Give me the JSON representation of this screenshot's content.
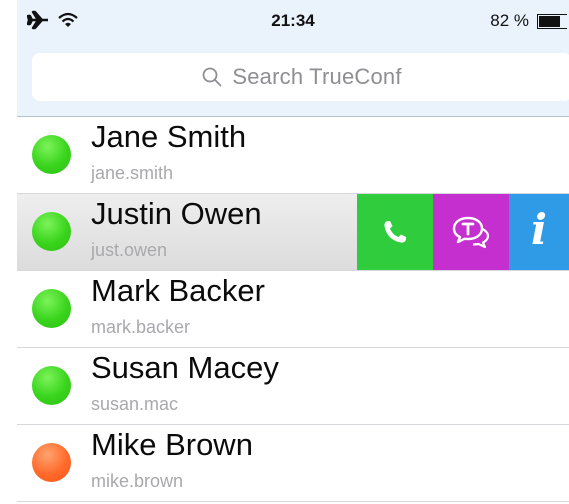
{
  "status_bar": {
    "airplane_icon": "airplane-icon",
    "wifi_icon": "wifi-icon",
    "time": "21:34",
    "battery_percent": "82 %",
    "battery_level": 0.82
  },
  "search": {
    "placeholder": "Search TrueConf"
  },
  "contacts": [
    {
      "name": "Jane Smith",
      "login": "jane.smith",
      "status": "online",
      "color": "#39d41c"
    },
    {
      "name": "Justin Owen",
      "login": "just.owen",
      "status": "online",
      "color": "#39d41c"
    },
    {
      "name": "Mark Backer",
      "login": "mark.backer",
      "status": "online",
      "color": "#39d41c"
    },
    {
      "name": "Susan Macey",
      "login": "susan.mac",
      "status": "online",
      "color": "#39d41c"
    },
    {
      "name": "Mike Brown",
      "login": "mike.brown",
      "status": "busy",
      "color": "#ff6a2a"
    }
  ],
  "swipe_actions": {
    "call": {
      "icon": "phone-icon",
      "color": "#2fcd3e"
    },
    "chat": {
      "icon": "chat-icon",
      "color": "#c62fcf"
    },
    "info": {
      "icon": "info-icon",
      "color": "#2f9ae6",
      "glyph": "i"
    }
  }
}
